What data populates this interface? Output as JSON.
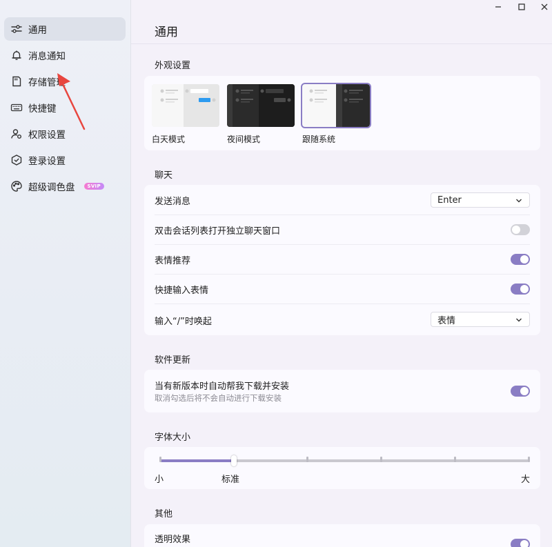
{
  "sidebar": {
    "items": [
      {
        "label": "通用",
        "icon": "sliders-icon",
        "active": true
      },
      {
        "label": "消息通知",
        "icon": "bell-icon"
      },
      {
        "label": "存储管理",
        "icon": "storage-card-icon"
      },
      {
        "label": "快捷键",
        "icon": "keyboard-icon"
      },
      {
        "label": "权限设置",
        "icon": "user-permission-icon"
      },
      {
        "label": "登录设置",
        "icon": "shield-icon"
      },
      {
        "label": "超级调色盘",
        "icon": "palette-icon",
        "badge": "SVIP"
      }
    ]
  },
  "window": {
    "controls": [
      "minimize-icon",
      "maximize-icon",
      "close-icon"
    ]
  },
  "main": {
    "title": "通用",
    "appearance": {
      "title": "外观设置",
      "themes": [
        {
          "label": "白天模式",
          "scheme": "light"
        },
        {
          "label": "夜间模式",
          "scheme": "dark"
        },
        {
          "label": "跟随系统",
          "scheme": "system",
          "selected": true
        }
      ]
    },
    "chat": {
      "title": "聊天",
      "send_label": "发送消息",
      "send_value": "Enter",
      "dblclick_label": "双击会话列表打开独立聊天窗口",
      "dblclick_on": false,
      "emoji_recommend_label": "表情推荐",
      "emoji_recommend_on": true,
      "quick_emoji_label": "快捷输入表情",
      "quick_emoji_on": true,
      "slash_label": "输入“/”时唤起",
      "slash_value": "表情"
    },
    "update": {
      "title": "软件更新",
      "auto_label": "当有新版本时自动帮我下载并安装",
      "auto_sub": "取消勾选后将不会自动进行下载安装",
      "auto_on": true
    },
    "font": {
      "title": "字体大小",
      "min_label": "小",
      "current_label": "标准",
      "max_label": "大",
      "steps": 6,
      "current_step": 1
    },
    "other": {
      "title": "其他",
      "transparent_label": "透明效果",
      "transparent_on": true
    }
  },
  "colors": {
    "accent": "#8a7dc4",
    "annotation_arrow": "#e8463f"
  }
}
